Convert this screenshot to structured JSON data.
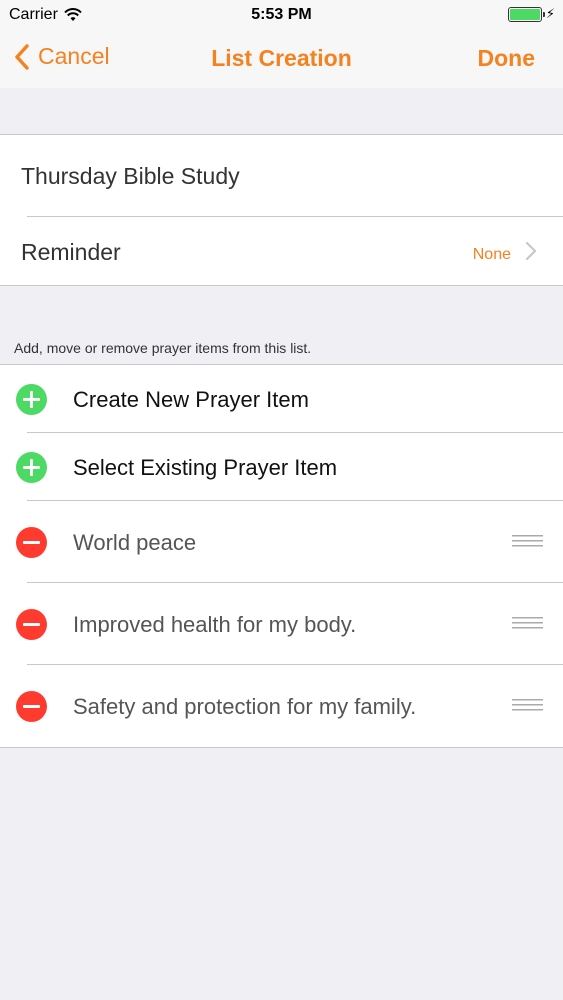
{
  "status_bar": {
    "carrier": "Carrier",
    "time": "5:53 PM",
    "icons": [
      "wifi-icon",
      "battery-icon",
      "charging-bolt-icon"
    ]
  },
  "nav": {
    "cancel_label": "Cancel",
    "title": "List Creation",
    "done_label": "Done",
    "accent_color": "#f5811f"
  },
  "list": {
    "name": "Thursday Bible Study",
    "reminder_label": "Reminder",
    "reminder_value": "None"
  },
  "section_note": "Add, move or remove prayer items from this list.",
  "actions": [
    {
      "label": "Create New Prayer Item",
      "icon": "add-circle-icon"
    },
    {
      "label": "Select Existing Prayer Item",
      "icon": "add-circle-icon"
    }
  ],
  "items": [
    {
      "label": "World peace",
      "icon": "remove-circle-icon"
    },
    {
      "label": "Improved health for my body.",
      "icon": "remove-circle-icon"
    },
    {
      "label": "Safety and protection for my family.",
      "icon": "remove-circle-icon"
    }
  ],
  "colors": {
    "add": "#4cd964",
    "remove": "#ff3b30",
    "background": "#efeff4"
  }
}
